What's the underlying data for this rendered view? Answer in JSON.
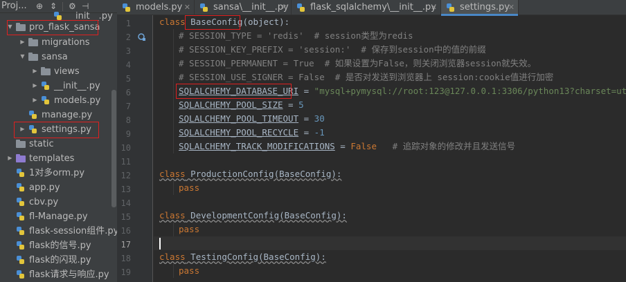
{
  "project": {
    "title": "Proj...",
    "toolbar_icons": [
      "globe-icon",
      "collapse-icon",
      "gear-icon",
      "hide-icon"
    ],
    "items": [
      {
        "label": "__init__.py",
        "icon": "py",
        "indent": 4
      },
      {
        "label": "pro_flask_sansa",
        "icon": "folder",
        "indent": 1,
        "expanded": true
      },
      {
        "label": "migrations",
        "icon": "folder",
        "indent": 2,
        "expanded": false
      },
      {
        "label": "sansa",
        "icon": "folder",
        "indent": 2,
        "expanded": true
      },
      {
        "label": "views",
        "icon": "folder",
        "indent": 3,
        "expanded": false
      },
      {
        "label": "__init__.py",
        "icon": "py",
        "indent": 3,
        "expanded": false
      },
      {
        "label": "models.py",
        "icon": "py",
        "indent": 3,
        "expanded": false
      },
      {
        "label": "manage.py",
        "icon": "py",
        "indent": 2
      },
      {
        "label": "settings.py",
        "icon": "py",
        "indent": 2,
        "expanded": false
      },
      {
        "label": "static",
        "icon": "folder",
        "indent": 1
      },
      {
        "label": "templates",
        "icon": "folder-purple",
        "indent": 1,
        "expanded": false
      },
      {
        "label": "1对多orm.py",
        "icon": "py",
        "indent": 1
      },
      {
        "label": "app.py",
        "icon": "py",
        "indent": 1
      },
      {
        "label": "cbv.py",
        "icon": "py",
        "indent": 1
      },
      {
        "label": "fl-Manage.py",
        "icon": "py",
        "indent": 1
      },
      {
        "label": "flask-session组件.py",
        "icon": "py",
        "indent": 1
      },
      {
        "label": "flask的信号.py",
        "icon": "py",
        "indent": 1
      },
      {
        "label": "flask的闪现.py",
        "icon": "py",
        "indent": 1
      },
      {
        "label": "flask请求与响应.py",
        "icon": "py",
        "indent": 1
      }
    ]
  },
  "tabs": [
    {
      "label": "models.py",
      "active": false
    },
    {
      "label": "sansa\\__init__.py",
      "active": false
    },
    {
      "label": "flask_sqlalchemy\\__init__.py",
      "active": false
    },
    {
      "label": "settings.py",
      "active": true
    }
  ],
  "editor": {
    "current_line": 17,
    "line_numbers": [
      "1",
      "2",
      "3",
      "4",
      "5",
      "6",
      "7",
      "8",
      "9",
      "10",
      "11",
      "12",
      "13",
      "14",
      "15",
      "16",
      "17",
      "18",
      "19"
    ],
    "code": {
      "l1": {
        "kw": "class",
        "name": "BaseConfig",
        "rest": "(object):"
      },
      "l2": "# SESSION_TYPE = 'redis'  # session类型为redis",
      "l3": "# SESSION_KEY_PREFIX = 'session:'  # 保存到session中的值的前缀",
      "l4": "# SESSION_PERMANENT = True  # 如果设置为False，则关闭浏览器session就失效。",
      "l5": "# SESSION_USE_SIGNER = False  # 是否对发送到浏览器上 session:cookie值进行加密",
      "l6": {
        "name": "SQLALCHEMY_DATABASE_URI",
        "op": " = ",
        "val": "\"mysql+pymysql://root:123@127.0.0.1:3306/python13?charset=utf8\""
      },
      "l7": {
        "name": "SQLALCHEMY_POOL_SIZE",
        "op": " = ",
        "val": "5"
      },
      "l8": {
        "name": "SQLALCHEMY_POOL_TIMEOUT",
        "op": " = ",
        "val": "30"
      },
      "l9": {
        "name": "SQLALCHEMY_POOL_RECYCLE",
        "op": " = ",
        "val": "-1"
      },
      "l10": {
        "name": "SQLALCHEMY_TRACK_MODIFICATIONS",
        "op": " = ",
        "val": "False",
        "comment": "# 追踪对象的修改并且发送信号"
      },
      "l13": {
        "kw": "class",
        "name": "ProductionConfig(BaseConfig):"
      },
      "l14": "pass",
      "l16": {
        "kw": "class",
        "name": "DevelopmentConfig(BaseConfig):"
      },
      "l17": "pass",
      "l19": {
        "kw": "class",
        "name": "TestingConfig(BaseConfig):"
      },
      "l20": "pass"
    }
  },
  "colors": {
    "highlight_box": "#e02020",
    "active_tab_underline": "#4a88c7"
  }
}
